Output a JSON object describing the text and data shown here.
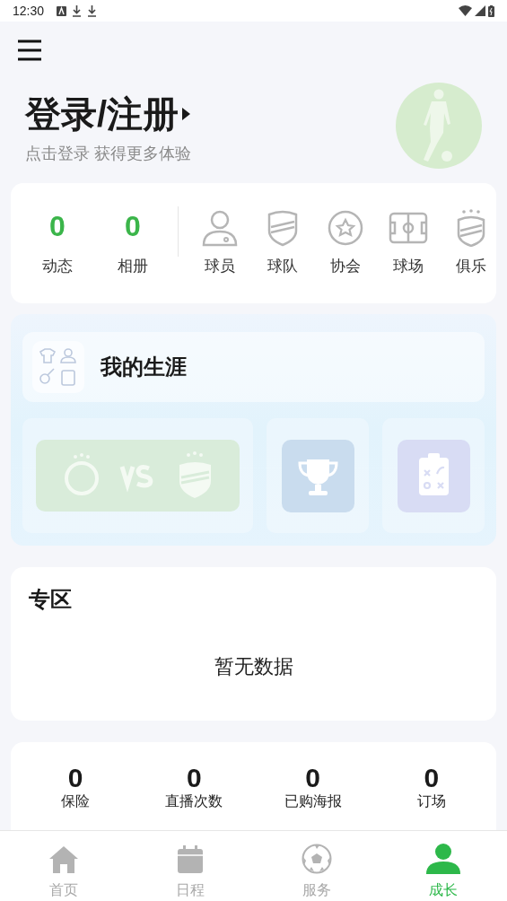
{
  "status_bar": {
    "time": "12:30"
  },
  "profile": {
    "title": "登录/注册",
    "subtitle": "点击登录 获得更多体验"
  },
  "counters": [
    {
      "value": "0",
      "label": "动态"
    },
    {
      "value": "0",
      "label": "相册"
    }
  ],
  "shortcuts": [
    {
      "kind": "player",
      "label": "球员"
    },
    {
      "kind": "team",
      "label": "球队"
    },
    {
      "kind": "association",
      "label": "协会"
    },
    {
      "kind": "field",
      "label": "球场"
    },
    {
      "kind": "club",
      "label": "俱乐"
    }
  ],
  "career": {
    "title": "我的生涯"
  },
  "zone": {
    "title": "专区",
    "empty_text": "暂无数据"
  },
  "stats": [
    {
      "value": "0",
      "label": "保险"
    },
    {
      "value": "0",
      "label": "直播次数"
    },
    {
      "value": "0",
      "label": "已购海报"
    },
    {
      "value": "0",
      "label": "订场"
    }
  ],
  "nav": [
    {
      "kind": "home",
      "label": "首页",
      "selected": false
    },
    {
      "kind": "calendar",
      "label": "日程",
      "selected": false
    },
    {
      "kind": "ball",
      "label": "服务",
      "selected": false
    },
    {
      "kind": "person",
      "label": "成长",
      "selected": true
    }
  ]
}
